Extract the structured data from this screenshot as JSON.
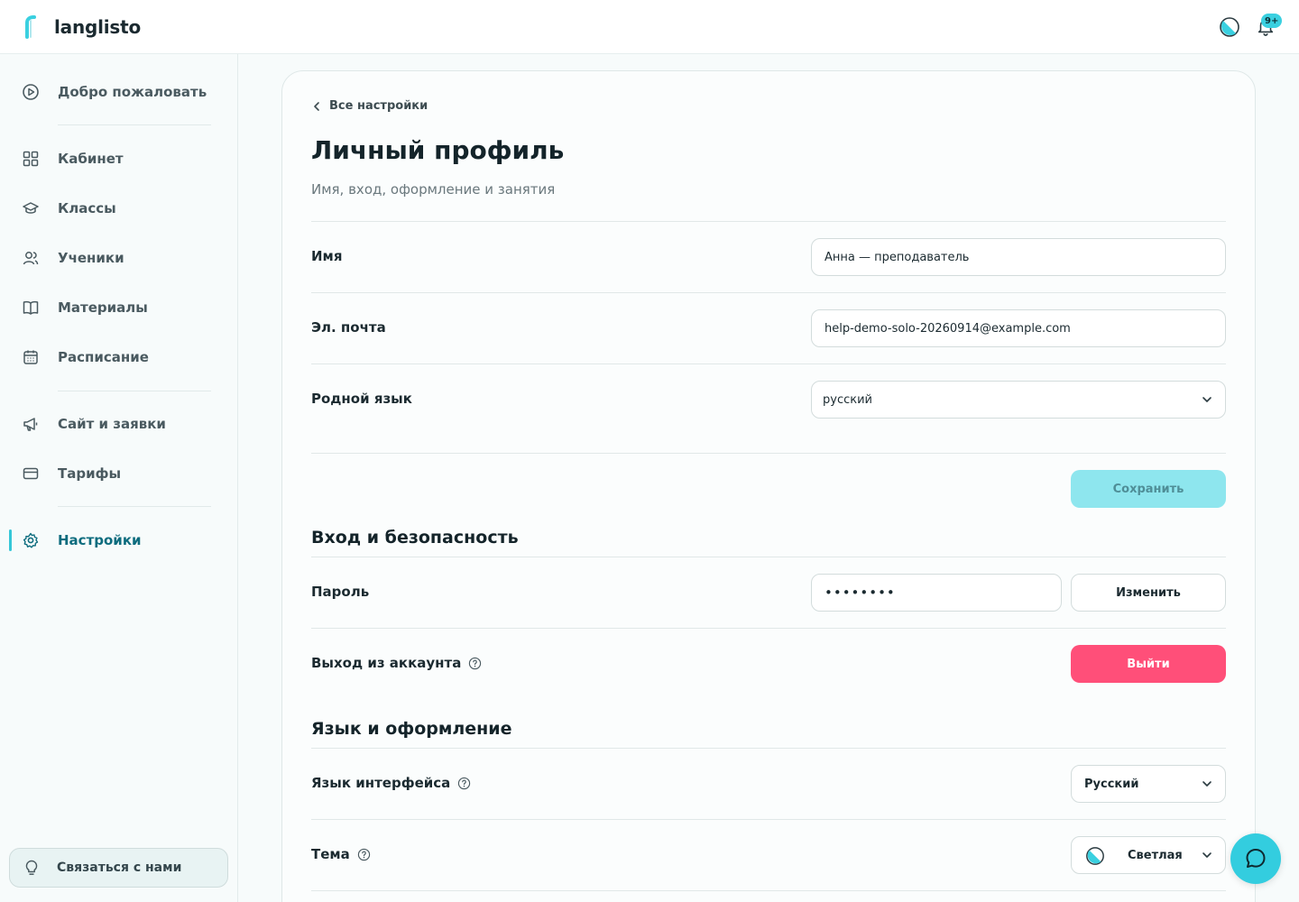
{
  "header": {
    "brand": "langlisto",
    "notifications_badge": "9+"
  },
  "sidebar": {
    "items": [
      {
        "label": "Добро пожаловать",
        "icon": "play-circle-icon"
      },
      {
        "label": "Кабинет",
        "icon": "dashboard-grid-icon"
      },
      {
        "label": "Классы",
        "icon": "graduation-cap-icon"
      },
      {
        "label": "Ученики",
        "icon": "users-icon"
      },
      {
        "label": "Материалы",
        "icon": "book-icon"
      },
      {
        "label": "Расписание",
        "icon": "calendar-icon"
      },
      {
        "label": "Сайт и заявки",
        "icon": "megaphone-icon"
      },
      {
        "label": "Тарифы",
        "icon": "credit-card-icon"
      },
      {
        "label": "Настройки",
        "icon": "gear-icon",
        "active": true
      }
    ],
    "contact_label": "Связаться с нами"
  },
  "page": {
    "back_label": "Все настройки",
    "title": "Личный профиль",
    "subtitle": "Имя, вход, оформление и занятия"
  },
  "profile": {
    "name_label": "Имя",
    "name_value": "Анна — преподаватель",
    "email_label": "Эл. почта",
    "email_value": "help-demo-solo-20260914@example.com",
    "native_language_label": "Родной язык",
    "native_language_value": "русский",
    "save_label": "Сохранить"
  },
  "security": {
    "section_title": "Вход и безопасность",
    "password_label": "Пароль",
    "password_value": "••••••••",
    "change_label": "Изменить",
    "logout_row_label": "Выход из аккаунта",
    "logout_button_label": "Выйти"
  },
  "appearance": {
    "section_title": "Язык и оформление",
    "interface_language_label": "Язык интерфейса",
    "interface_language_value": "Русский",
    "theme_label": "Тема",
    "theme_value": "Светлая"
  },
  "colors": {
    "accent": "#33cddf",
    "active_nav": "#0d6c7e",
    "danger": "#ff4f79",
    "save_disabled": "#8ee6ee"
  }
}
